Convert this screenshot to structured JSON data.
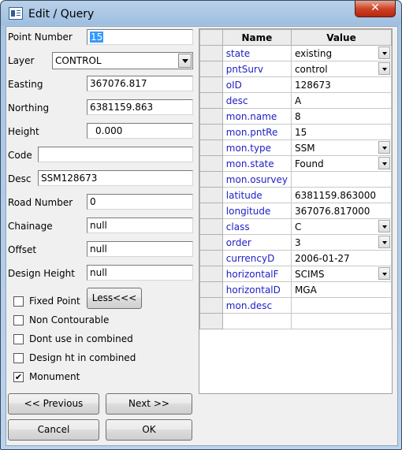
{
  "window": {
    "title": "Edit / Query",
    "close_glyph": "✕",
    "app_icon": "window-icon"
  },
  "form": {
    "point_number": {
      "label": "Point Number",
      "value": "15"
    },
    "layer": {
      "label": "Layer",
      "value": "CONTROL"
    },
    "easting": {
      "label": "Easting",
      "value": "367076.817"
    },
    "northing": {
      "label": "Northing",
      "value": "6381159.863"
    },
    "height": {
      "label": "Height",
      "value": "0.000"
    },
    "code": {
      "label": "Code",
      "value": ""
    },
    "desc": {
      "label": "Desc",
      "value": "SSM128673"
    },
    "road_number": {
      "label": "Road Number",
      "value": "0"
    },
    "chainage": {
      "label": "Chainage",
      "value": "null"
    },
    "offset": {
      "label": "Offset",
      "value": "null"
    },
    "design_height": {
      "label": "Design Height",
      "value": "null"
    }
  },
  "checkboxes": [
    {
      "label": "Fixed Point",
      "checked": false
    },
    {
      "label": "Non Contourable",
      "checked": false
    },
    {
      "label": "Dont use in combined",
      "checked": false
    },
    {
      "label": "Design ht in combined",
      "checked": false
    },
    {
      "label": "Monument",
      "checked": true
    }
  ],
  "check_mark": "✔",
  "buttons": {
    "less": "Less<<<",
    "previous": "<< Previous",
    "next": "Next >>",
    "cancel": "Cancel",
    "ok": "OK"
  },
  "grid": {
    "headers": [
      "Name",
      "Value"
    ],
    "rows": [
      {
        "name": "state",
        "value": "existing",
        "dropdown": true
      },
      {
        "name": "pntSurv",
        "value": "control",
        "dropdown": true
      },
      {
        "name": "oID",
        "value": "128673",
        "dropdown": false
      },
      {
        "name": "desc",
        "value": "A",
        "dropdown": false
      },
      {
        "name": "mon.name",
        "value": "8",
        "dropdown": false
      },
      {
        "name": "mon.pntRe",
        "value": "15",
        "dropdown": false
      },
      {
        "name": "mon.type",
        "value": "SSM",
        "dropdown": true
      },
      {
        "name": "mon.state",
        "value": "Found",
        "dropdown": true
      },
      {
        "name": "mon.osurvey",
        "value": "",
        "dropdown": false
      },
      {
        "name": "latitude",
        "value": "6381159.863000",
        "dropdown": false
      },
      {
        "name": "longitude",
        "value": "367076.817000",
        "dropdown": false
      },
      {
        "name": "class",
        "value": "C",
        "dropdown": true
      },
      {
        "name": "order",
        "value": "3",
        "dropdown": true
      },
      {
        "name": "currencyD",
        "value": "2006-01-27",
        "dropdown": false
      },
      {
        "name": "horizontalF",
        "value": "SCIMS",
        "dropdown": true
      },
      {
        "name": "horizontalD",
        "value": "MGA",
        "dropdown": false
      },
      {
        "name": "mon.desc",
        "value": "",
        "dropdown": false
      },
      {
        "name": "",
        "value": "",
        "dropdown": false
      }
    ]
  }
}
